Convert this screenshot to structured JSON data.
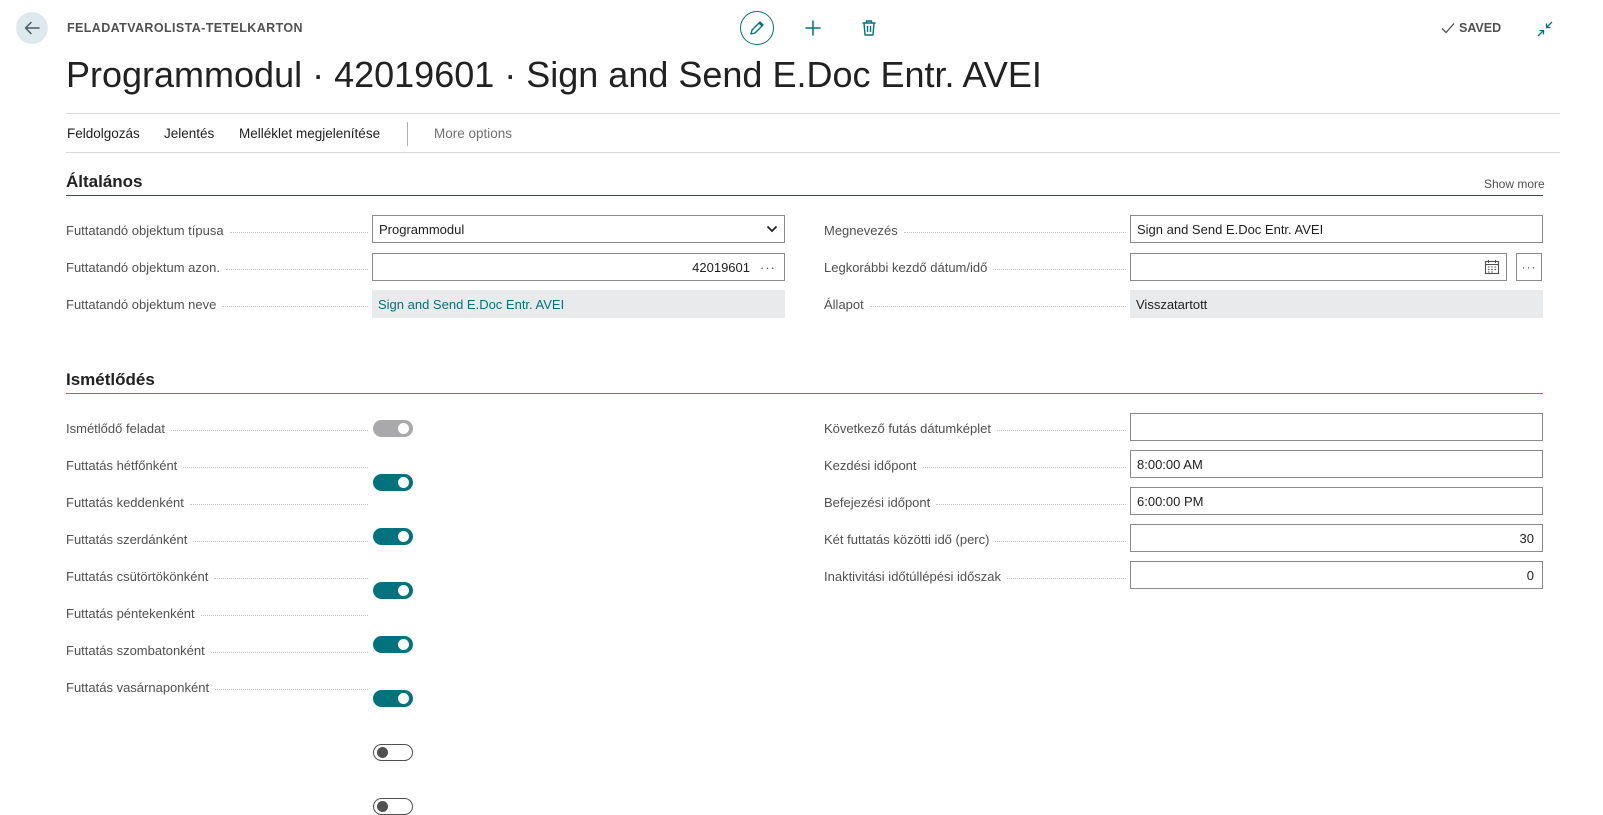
{
  "header": {
    "caption": "FELADATVAROLISTA-TETELKARTON",
    "title": "Programmodul · 42019601 · Sign and Send E.Doc Entr. AVEI",
    "saved": "SAVED"
  },
  "actions": {
    "feldolgozas": "Feldolgozás",
    "jelentes": "Jelentés",
    "melleklet": "Melléklet megjelenítése",
    "more": "More options"
  },
  "general": {
    "title": "Általános",
    "show_more": "Show more",
    "fields": {
      "object_type_label": "Futtatandó objektum típusa",
      "object_type_value": "Programmodul",
      "object_id_label": "Futtatandó objektum azon.",
      "object_id_value": "42019601",
      "object_name_label": "Futtatandó objektum neve",
      "object_name_value": "Sign and Send E.Doc Entr. AVEI",
      "description_label": "Megnevezés",
      "description_value": "Sign and Send E.Doc Entr. AVEI",
      "earliest_start_label": "Legkorábbi kezdő dátum/idő",
      "earliest_start_value": "",
      "status_label": "Állapot",
      "status_value": "Visszatartott"
    }
  },
  "recurrence": {
    "title": "Ismétlődés",
    "toggles": [
      {
        "label": "Ismétlődő feladat",
        "state": "disabled"
      },
      {
        "label": "Futtatás hétfőnként",
        "state": "on"
      },
      {
        "label": "Futtatás keddenként",
        "state": "on"
      },
      {
        "label": "Futtatás szerdánként",
        "state": "on"
      },
      {
        "label": "Futtatás csütörtökönként",
        "state": "on"
      },
      {
        "label": "Futtatás péntekenként",
        "state": "on"
      },
      {
        "label": "Futtatás szombatonként",
        "state": "off"
      },
      {
        "label": "Futtatás vasárnaponként",
        "state": "off"
      }
    ],
    "fields": {
      "next_run_formula_label": "Következő futás dátumképlet",
      "next_run_formula_value": "",
      "start_time_label": "Kezdési időpont",
      "start_time_value": "8:00:00 AM",
      "end_time_label": "Befejezési időpont",
      "end_time_value": "6:00:00 PM",
      "minutes_between_label": "Két futtatás közötti idő (perc)",
      "minutes_between_value": "30",
      "inactivity_label": "Inaktivitási időtúllépési időszak",
      "inactivity_value": "0"
    }
  },
  "colors": {
    "accent": "#00737e",
    "section_rule_general": "#3a4a55",
    "section_rule_recurrence": "#2d9aa3"
  },
  "icons": {
    "back": "arrow-left-icon",
    "edit": "pencil-icon",
    "new": "plus-icon",
    "delete": "trash-icon",
    "saved": "check-icon",
    "collapse": "collapse-icon",
    "dropdown": "chevron-down-icon",
    "calendar": "calendar-icon"
  }
}
